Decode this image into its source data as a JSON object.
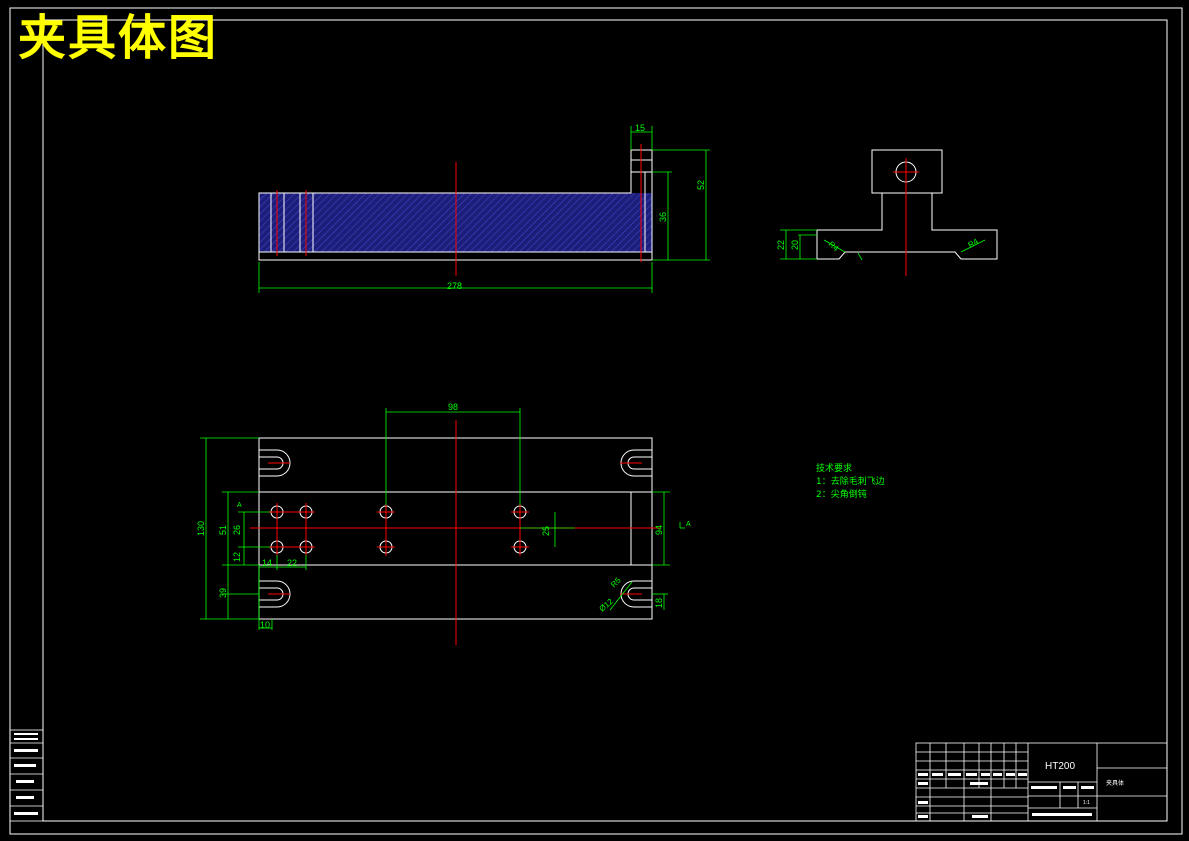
{
  "title": "夹具体图",
  "dimensions": {
    "d15": "15",
    "d52": "52",
    "d36": "36",
    "d278": "278",
    "d22": "22",
    "d20": "20",
    "r4a": "R4",
    "r4b": "R4",
    "d98": "98",
    "d130": "130",
    "d51": "51",
    "d26": "26",
    "d12": "12",
    "d39": "39",
    "d14": "14",
    "d22b": "22",
    "d10": "10",
    "d25": "25",
    "d94": "94",
    "d18": "18",
    "r5": "R5",
    "phi12": "Ø12"
  },
  "section_marker": "A",
  "notes": {
    "heading": "技术要求",
    "line1": "1：去除毛刺飞边",
    "line2": "2：尖角倒钝"
  },
  "title_block": {
    "material": "HT200",
    "part_name": "夹具体",
    "scale": "1:1"
  },
  "colors": {
    "border": "#ffffff",
    "outline": "#ffffff",
    "dimension": "#00ff00",
    "centerline": "#ff0000",
    "hatch": "#2a2a9a",
    "title": "#ffff00"
  }
}
